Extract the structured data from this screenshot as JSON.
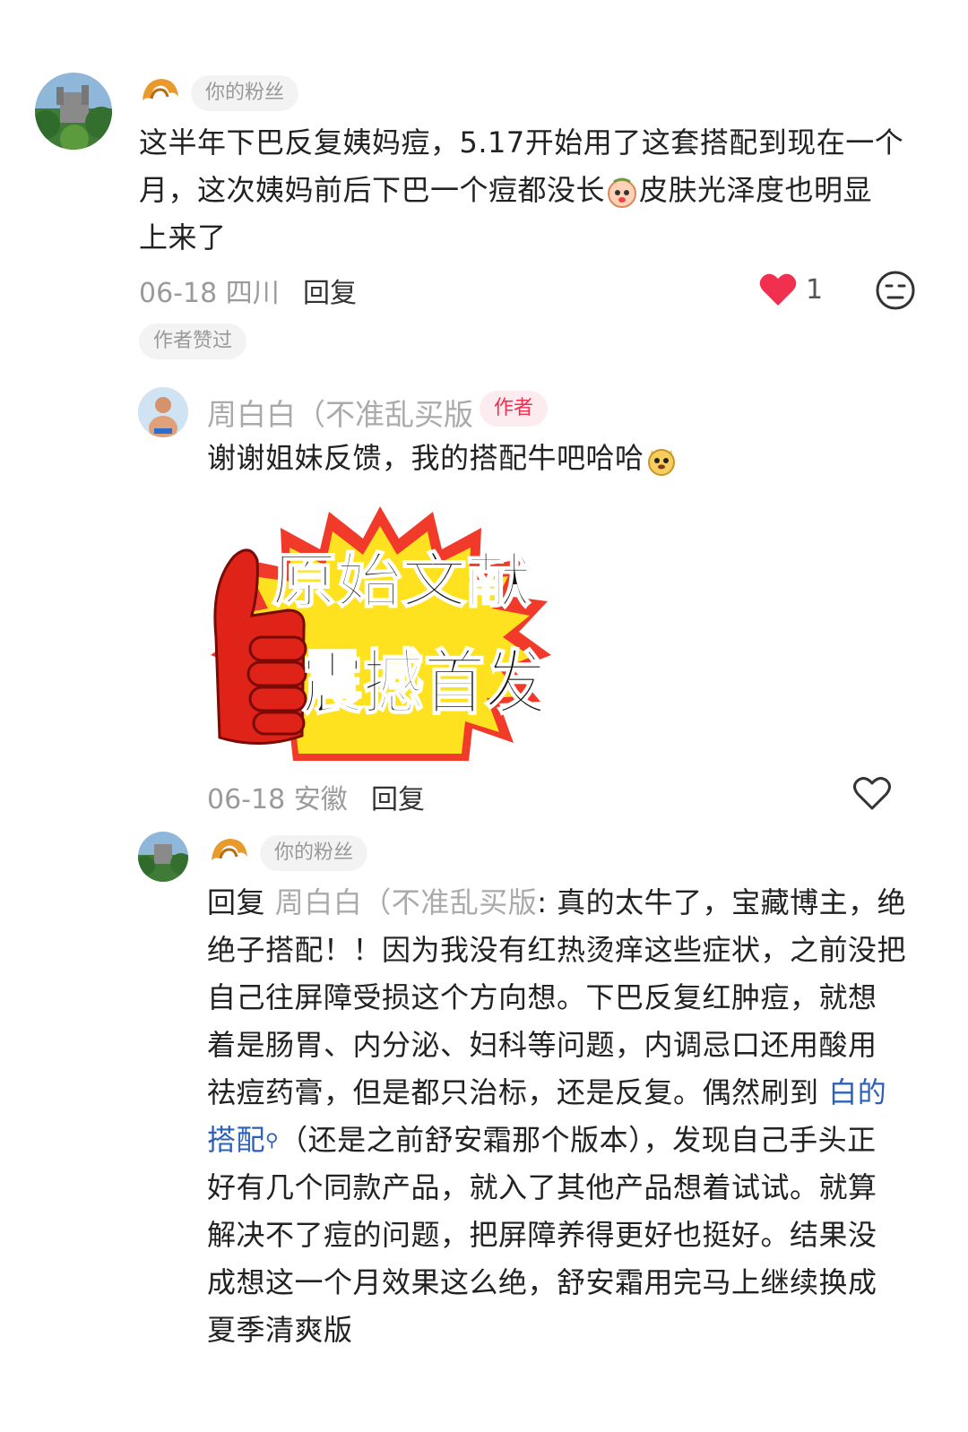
{
  "comment1": {
    "tag": "你的粉丝",
    "text_line1": "这半年下巴反复姨妈痘，5.17开始用了这套搭配到现在一个",
    "text_line2a": "月，这次姨妈前后下巴一个痘都没长",
    "text_line2b": "皮肤光泽度也明显",
    "text_line3": "上来了",
    "date_loc": "06-18 四川",
    "reply_label": "回复",
    "like_count": "1",
    "author_liked": "作者赞过"
  },
  "reply1": {
    "name": "周白白（不准乱买版",
    "badge": "作者",
    "text": "谢谢姐妹反馈，我的搭配牛吧哈哈",
    "sticker_line1": "原始文献",
    "sticker_line2": "震撼首发",
    "date_loc": "06-18 安徽",
    "reply_label": "回复"
  },
  "reply2": {
    "tag": "你的粉丝",
    "reply_prefix": "回复 ",
    "reply_to": "周白白（不准乱买版",
    "colon": ":",
    "line1_rest": " 真的太牛了，宝藏博主，绝",
    "line2": "绝子搭配！！因为我没有红热烫痒这些症状，之前没把",
    "line3": "自己往屏障受损这个方向想。下巴反复红肿痘，就想",
    "line4": "着是肠胃、内分泌、妇科等问题，内调忌口还用酸用",
    "line5a": "祛痘药膏，但是都只治标，还是反复。偶然刷到 ",
    "line5_link": "白的",
    "line6_link": "搭配",
    "line6_rest": "（还是之前舒安霜那个版本），发现自己手头正",
    "line7": "好有几个同款产品，就入了其他产品想着试试。就算",
    "line8": "解决不了痘的问题，把屏障养得更好也挺好。结果没",
    "line9": "成想这一个月效果这么绝，舒安霜用完马上继续换成",
    "line10": "夏季清爽版"
  },
  "colors": {
    "heart": "#f0304e",
    "link": "#2e60b8",
    "badge_bg": "#fdecef"
  }
}
